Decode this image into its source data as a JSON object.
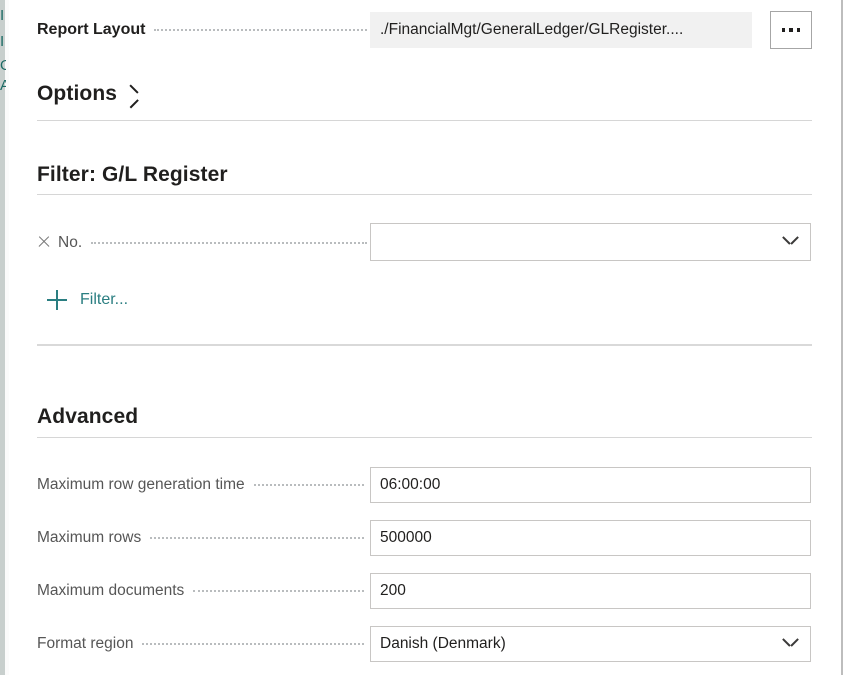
{
  "report_layout": {
    "label": "Report Layout",
    "value": "./FinancialMgt/GeneralLedger/GLRegister....",
    "ellipsis_label": "..."
  },
  "options_section": {
    "heading": "Options"
  },
  "filter_section": {
    "heading": "Filter: G/L Register",
    "rows": [
      {
        "label": "No.",
        "value": "",
        "placeholder": ""
      }
    ],
    "add_filter_label": "Filter..."
  },
  "advanced_section": {
    "heading": "Advanced",
    "rows": [
      {
        "label": "Maximum row generation time",
        "value": "06:00:00",
        "type": "text"
      },
      {
        "label": "Maximum rows",
        "value": "500000",
        "type": "text"
      },
      {
        "label": "Maximum documents",
        "value": "200",
        "type": "text"
      },
      {
        "label": "Format region",
        "value": "Danish (Denmark)",
        "type": "dropdown"
      }
    ]
  },
  "colors": {
    "accent_teal": "#2a7e81",
    "label_grey": "#565656",
    "border_grey": "#c8c6c4",
    "readonly_bg": "#f1f1f1"
  },
  "left_strip_glyphs": [
    "I",
    "I",
    "O",
    "A"
  ]
}
